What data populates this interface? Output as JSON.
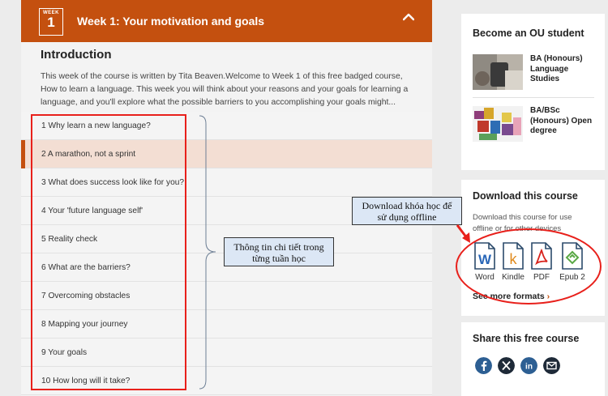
{
  "week": {
    "badge_label": "WEEK",
    "badge_number": "1",
    "title": "Week 1: Your motivation and goals"
  },
  "intro": {
    "heading": "Introduction",
    "text": "This week of the course is written by Tita Beaven.Welcome to Week 1 of this free badged course, How to learn a language. This week you will think about your reasons and your goals for learning a language, and you'll explore what the possible barriers to you accomplishing your goals might..."
  },
  "sections": [
    "1 Why learn a new language?",
    "2 A marathon, not a sprint",
    "3 What does success look like for you?",
    "4 Your 'future language self'",
    "5 Reality check",
    "6 What are the barriers?",
    "7 Overcoming obstacles",
    "8 Mapping your journey",
    "9 Your goals",
    "10 How long will it take?"
  ],
  "annotations": {
    "details_note": "Thông tin chi tiết trong từng tuần học",
    "download_note": "Download khóa học để sử dụng offline"
  },
  "sidebar": {
    "become_student": {
      "title": "Become an OU student",
      "items": [
        "BA (Honours) Language Studies",
        "BA/BSc (Honours) Open degree"
      ]
    },
    "download": {
      "title": "Download this course",
      "description": "Download this course for use offline or for other devices",
      "formats": [
        "Word",
        "Kindle",
        "PDF",
        "Epub 2"
      ],
      "see_more": "See more formats"
    },
    "share": {
      "title": "Share this free course",
      "icons": [
        "facebook-icon",
        "x-icon",
        "linkedin-icon",
        "email-icon"
      ]
    }
  },
  "colors": {
    "brand_orange": "#c4500f",
    "annotation_red": "#e8201b",
    "note_bg": "#dce7f5"
  }
}
